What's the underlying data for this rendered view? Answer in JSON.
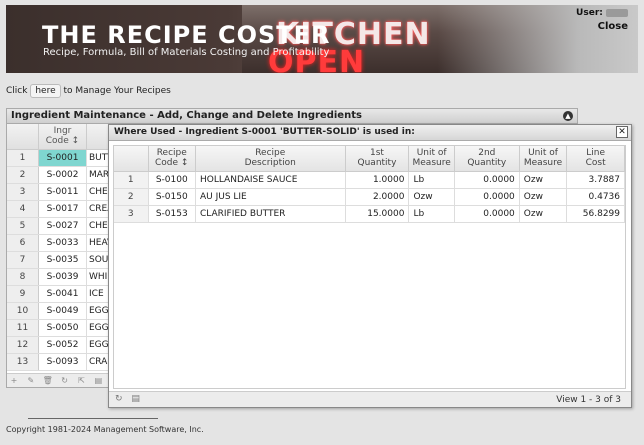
{
  "banner": {
    "brand": "THE RECIPE COSTER",
    "tagline": "Recipe, Formula, Bill of Materials Costing and Profitability",
    "sign_top": "KITCHEN",
    "sign_bottom": "OPEN",
    "user_label": "User:",
    "close_label": "Close"
  },
  "manage": {
    "prefix": "Click",
    "link": "here",
    "suffix": "to Manage Your Recipes"
  },
  "ingredients": {
    "title": "Ingredient Maintenance - Add, Change and Delete Ingredients",
    "col_code_line1": "Ingr",
    "col_code_line2": "Code",
    "rows": [
      {
        "n": "1",
        "code": "S-0001",
        "desc": "BUTTER-SOLID"
      },
      {
        "n": "2",
        "code": "S-0002",
        "desc": "MARGARINE"
      },
      {
        "n": "3",
        "code": "S-0011",
        "desc": "CHEESE"
      },
      {
        "n": "4",
        "code": "S-0017",
        "desc": "CREAM"
      },
      {
        "n": "5",
        "code": "S-0027",
        "desc": "CHEESE"
      },
      {
        "n": "6",
        "code": "S-0033",
        "desc": "HEAVY"
      },
      {
        "n": "7",
        "code": "S-0035",
        "desc": "SOUR"
      },
      {
        "n": "8",
        "code": "S-0039",
        "desc": "WHIP"
      },
      {
        "n": "9",
        "code": "S-0041",
        "desc": "ICE"
      },
      {
        "n": "10",
        "code": "S-0049",
        "desc": "EGG"
      },
      {
        "n": "11",
        "code": "S-0050",
        "desc": "EGG"
      },
      {
        "n": "12",
        "code": "S-0052",
        "desc": "EGG"
      },
      {
        "n": "13",
        "code": "S-0093",
        "desc": "CRAB"
      }
    ]
  },
  "modal": {
    "title": "Where Used - Ingredient S-0001 'BUTTER-SOLID' is used in:",
    "headers": {
      "recipe_code": [
        "Recipe",
        "Code"
      ],
      "recipe_desc": [
        "Recipe",
        "Description"
      ],
      "qty1": [
        "1st",
        "Quantity"
      ],
      "uom1": [
        "Unit of",
        "Measure"
      ],
      "qty2": [
        "2nd",
        "Quantity"
      ],
      "uom2": [
        "Unit of",
        "Measure"
      ],
      "cost": [
        "Line",
        "Cost"
      ]
    },
    "rows": [
      {
        "n": "1",
        "code": "S-0100",
        "desc": "HOLLANDAISE SAUCE",
        "qty1": "1.0000",
        "uom1": "Lb",
        "qty2": "0.0000",
        "uom2": "Ozw",
        "cost": "3.7887"
      },
      {
        "n": "2",
        "code": "S-0150",
        "desc": "AU JUS LIE",
        "qty1": "2.0000",
        "uom1": "Ozw",
        "qty2": "0.0000",
        "uom2": "Ozw",
        "cost": "0.4736"
      },
      {
        "n": "3",
        "code": "S-0153",
        "desc": "CLARIFIED BUTTER",
        "qty1": "15.0000",
        "uom1": "Lb",
        "qty2": "0.0000",
        "uom2": "Ozw",
        "cost": "56.8299"
      }
    ],
    "view_text": "View 1 - 3 of 3"
  },
  "copyright": "Copyright 1981-2024 Management Software, Inc."
}
